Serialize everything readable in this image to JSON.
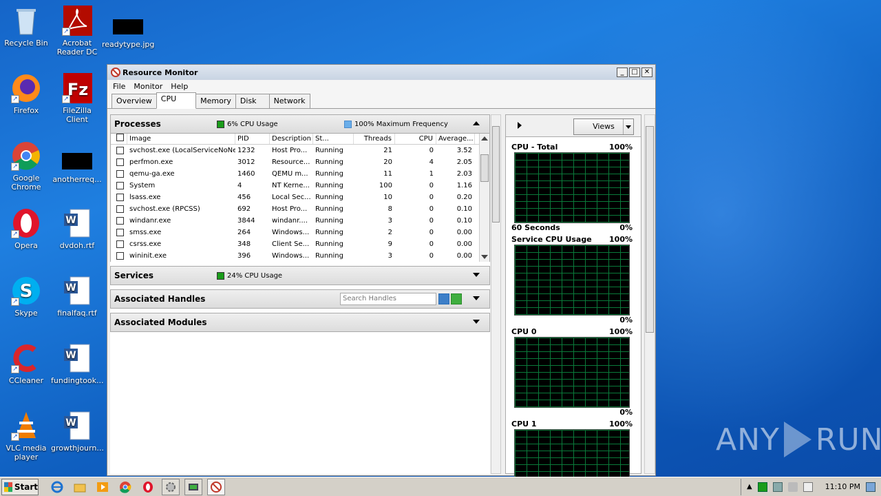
{
  "desktop": {
    "icons": [
      {
        "label": "Recycle Bin"
      },
      {
        "label": "Acrobat Reader DC"
      },
      {
        "label": "readytype.jpg"
      },
      {
        "label": "Firefox"
      },
      {
        "label": "FileZilla Client"
      },
      {
        "label": "Google Chrome"
      },
      {
        "label": "anotherreq..."
      },
      {
        "label": "Opera"
      },
      {
        "label": "dvdoh.rtf"
      },
      {
        "label": "Skype"
      },
      {
        "label": "finalfaq.rtf"
      },
      {
        "label": "CCleaner"
      },
      {
        "label": "fundingtook..."
      },
      {
        "label": "VLC media player"
      },
      {
        "label": "growthjourn..."
      }
    ]
  },
  "window": {
    "title": "Resource Monitor",
    "menu": [
      "File",
      "Monitor",
      "Help"
    ],
    "tabs": [
      "Overview",
      "CPU",
      "Memory",
      "Disk",
      "Network"
    ],
    "active_tab": "CPU"
  },
  "processes": {
    "title": "Processes",
    "cpu_usage": "6% CPU Usage",
    "max_freq": "100% Maximum Frequency",
    "columns": [
      "Image",
      "PID",
      "Description",
      "St...",
      "Threads",
      "CPU",
      "Average..."
    ],
    "rows": [
      [
        "svchost.exe (LocalServiceNoNet...",
        "1232",
        "Host Pro...",
        "Running",
        "21",
        "0",
        "3.52"
      ],
      [
        "perfmon.exe",
        "3012",
        "Resource...",
        "Running",
        "20",
        "4",
        "2.05"
      ],
      [
        "qemu-ga.exe",
        "1460",
        "QEMU m...",
        "Running",
        "11",
        "1",
        "2.03"
      ],
      [
        "System",
        "4",
        "NT Kerne...",
        "Running",
        "100",
        "0",
        "1.16"
      ],
      [
        "lsass.exe",
        "456",
        "Local Sec...",
        "Running",
        "10",
        "0",
        "0.20"
      ],
      [
        "svchost.exe (RPCSS)",
        "692",
        "Host Pro...",
        "Running",
        "8",
        "0",
        "0.10"
      ],
      [
        "windanr.exe",
        "3844",
        "windanr....",
        "Running",
        "3",
        "0",
        "0.10"
      ],
      [
        "smss.exe",
        "264",
        "Windows...",
        "Running",
        "2",
        "0",
        "0.00"
      ],
      [
        "csrss.exe",
        "348",
        "Client Se...",
        "Running",
        "9",
        "0",
        "0.00"
      ],
      [
        "wininit.exe",
        "396",
        "Windows...",
        "Running",
        "3",
        "0",
        "0.00"
      ]
    ]
  },
  "services": {
    "title": "Services",
    "cpu_usage": "24% CPU Usage"
  },
  "handles": {
    "title": "Associated Handles",
    "search_placeholder": "Search Handles"
  },
  "modules": {
    "title": "Associated Modules"
  },
  "graphs": {
    "views_label": "Views",
    "items": [
      {
        "title": "CPU - Total",
        "max": "100%",
        "footer_left": "60 Seconds",
        "footer_right": "0%"
      },
      {
        "title": "Service CPU Usage",
        "max": "100%",
        "footer_left": "",
        "footer_right": "0%"
      },
      {
        "title": "CPU 0",
        "max": "100%",
        "footer_left": "",
        "footer_right": "0%"
      },
      {
        "title": "CPU 1",
        "max": "100%",
        "footer_left": "",
        "footer_right": ""
      }
    ]
  },
  "watermark": {
    "left": "ANY",
    "right": "RUN"
  },
  "taskbar": {
    "start_label": "Start",
    "clock": "11:10 PM"
  },
  "colors": {
    "green_indicator": "#1a9c1a",
    "blue_indicator": "#6aaeea",
    "graph_grid": "#0a7a3a"
  }
}
